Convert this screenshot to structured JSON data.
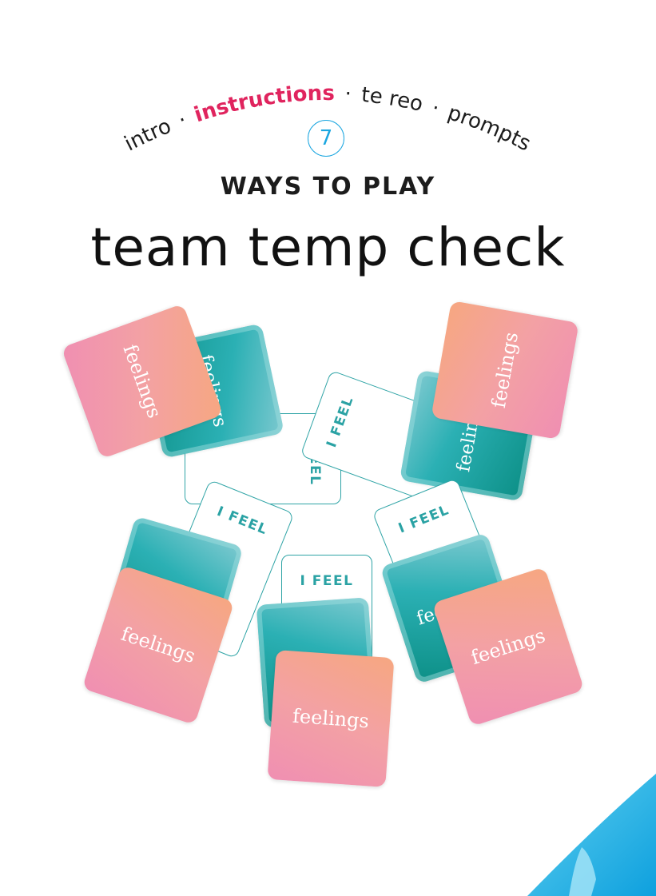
{
  "nav": {
    "intro": "intro",
    "instructions": "instructions",
    "te_reo": "te reo",
    "prompts": "prompts",
    "separator": "·",
    "active_color": "#e0245e"
  },
  "page_number": "7",
  "subtitle": "WAYS TO PLAY",
  "title": "team temp check",
  "cards": {
    "i_feel_label": "I FEEL",
    "feelings_label": "feelings"
  },
  "colors": {
    "accent_blue": "#1aa6e0",
    "teal": "#2aa2a4",
    "pink": "#f3a1a4"
  }
}
